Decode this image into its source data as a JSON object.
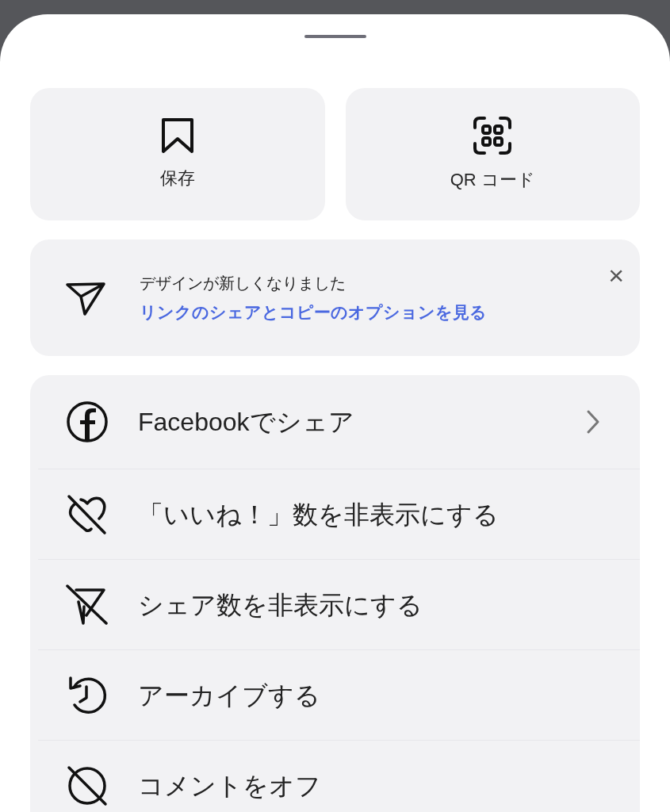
{
  "top_actions": [
    {
      "label": "保存"
    },
    {
      "label": "QR コード"
    }
  ],
  "banner": {
    "title": "デザインが新しくなりました",
    "link": "リンクのシェアとコピーのオプションを見る",
    "close": "×"
  },
  "menu": [
    {
      "label": "Facebookでシェア",
      "chevron": true
    },
    {
      "label": "「いいね！」数を非表示にする",
      "chevron": false
    },
    {
      "label": "シェア数を非表示にする",
      "chevron": false
    },
    {
      "label": "アーカイブする",
      "chevron": false
    },
    {
      "label": "コメントをオフ",
      "chevron": false
    }
  ]
}
